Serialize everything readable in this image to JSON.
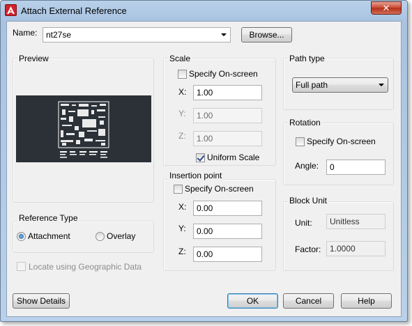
{
  "window": {
    "title": "Attach External Reference",
    "close_glyph": "✕",
    "app_icon": "autocad-icon"
  },
  "name_row": {
    "label": "Name:",
    "value": "nt27se",
    "browse_label": "Browse..."
  },
  "preview": {
    "title": "Preview",
    "background": "#2b3137"
  },
  "scale": {
    "title": "Scale",
    "specify_label": "Specify On-screen",
    "specify_checked": false,
    "x_label": "X:",
    "x_value": "1.00",
    "y_label": "Y:",
    "y_value": "1.00",
    "z_label": "Z:",
    "z_value": "1.00",
    "uniform_label": "Uniform Scale",
    "uniform_checked": true
  },
  "insertion": {
    "title": "Insertion point",
    "specify_label": "Specify On-screen",
    "specify_checked": false,
    "x_label": "X:",
    "x_value": "0.00",
    "y_label": "Y:",
    "y_value": "0.00",
    "z_label": "Z:",
    "z_value": "0.00"
  },
  "path_type": {
    "title": "Path type",
    "value": "Full path"
  },
  "rotation": {
    "title": "Rotation",
    "specify_label": "Specify On-screen",
    "specify_checked": false,
    "angle_label": "Angle:",
    "angle_value": "0"
  },
  "block_unit": {
    "title": "Block Unit",
    "unit_label": "Unit:",
    "unit_value": "Unitless",
    "factor_label": "Factor:",
    "factor_value": "1.0000"
  },
  "reference_type": {
    "title": "Reference Type",
    "attachment_label": "Attachment",
    "overlay_label": "Overlay",
    "selected": "Attachment"
  },
  "geo": {
    "label": "Locate using Geographic Data",
    "checked": false,
    "enabled": false
  },
  "buttons": {
    "details": "Show Details",
    "ok": "OK",
    "cancel": "Cancel",
    "help": "Help"
  },
  "colors": {
    "titlebar": "#b9d1ea",
    "close": "#c7442e",
    "dialog_bg": "#f0f0f0"
  }
}
